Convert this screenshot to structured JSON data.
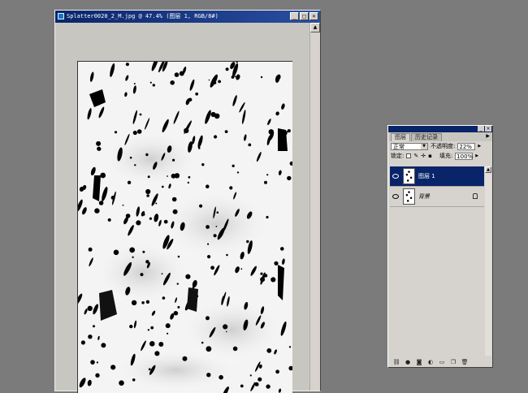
{
  "document_window": {
    "title": "Splatter0020_2_M.jpg @ 47.4% (图层 1, RGB/8#)",
    "buttons": {
      "minimize": "_",
      "maximize": "□",
      "close": "×"
    },
    "scroll": {
      "up": "▲",
      "down": "▼"
    }
  },
  "layers_panel": {
    "tabs": [
      "图层",
      "历史记录"
    ],
    "menu_arrow": "▶",
    "blend_mode": "正常",
    "opacity_label": "不透明度:",
    "opacity_value": "22%",
    "lock_label": "锁定:",
    "fill_label": "填充:",
    "fill_value": "100%",
    "layers": [
      {
        "name": "图层 1",
        "selected": true
      },
      {
        "name": "背景",
        "selected": false,
        "locked": true
      }
    ],
    "footer_icons": [
      "link-icon",
      "fx-icon",
      "mask-icon",
      "adjustment-icon",
      "folder-icon",
      "new-layer-icon",
      "trash-icon"
    ],
    "title_buttons": {
      "minimize": "_",
      "close": "×"
    }
  },
  "colors": {
    "selection": "#0a246a",
    "workspace": "#7b7b7b",
    "panel": "#d6d3ce"
  }
}
